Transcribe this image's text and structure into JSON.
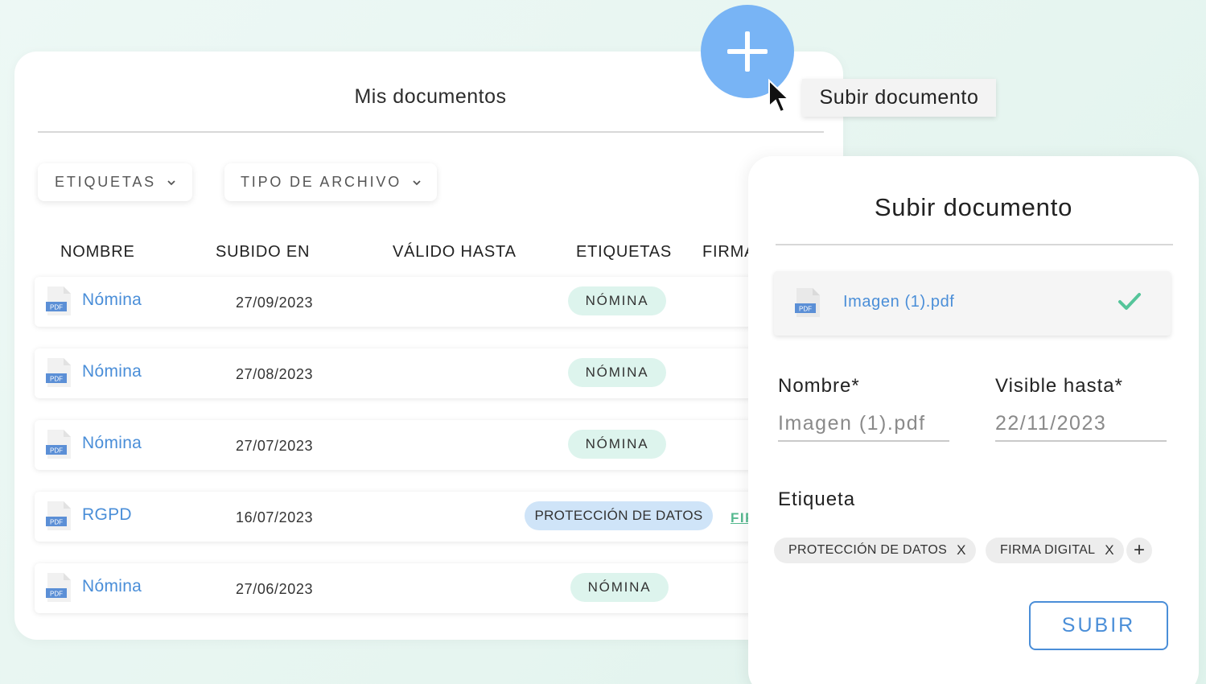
{
  "docs": {
    "title": "Mis documentos",
    "filters": [
      {
        "label": "ETIQUETAS"
      },
      {
        "label": "TIPO DE ARCHIVO"
      }
    ],
    "columns": [
      "NOMBRE",
      "SUBIDO EN",
      "VÁLIDO HASTA",
      "ETIQUETAS",
      "FIRMA"
    ],
    "rows": [
      {
        "name": "Nómina",
        "date": "27/09/2023",
        "tag": "NÓMINA",
        "icon_label": "PDF"
      },
      {
        "name": "Nómina",
        "date": "27/08/2023",
        "tag": "NÓMINA",
        "icon_label": "PDF"
      },
      {
        "name": "Nómina",
        "date": "27/07/2023",
        "tag": "NÓMINA",
        "icon_label": "PDF"
      },
      {
        "name": "RGPD",
        "date": "16/07/2023",
        "tag": "PROTECCIÓN DE DATOS",
        "firma": "FIF",
        "icon_label": "PDF"
      },
      {
        "name": "Nómina",
        "date": "27/06/2023",
        "tag": "NÓMINA",
        "icon_label": "PDF"
      }
    ]
  },
  "fab": {
    "icon": "plus-icon",
    "color": "#78b4f5"
  },
  "tooltip": {
    "text": "Subir documento"
  },
  "modal": {
    "title": "Subir documento",
    "file": {
      "name": "Imagen (1).pdf",
      "icon_label": "PDF",
      "status_icon": "check-icon"
    },
    "nombre_label": "Nombre*",
    "nombre_value": "Imagen (1).pdf",
    "visible_label": "Visible hasta*",
    "visible_value": "22/11/2023",
    "etiqueta_label": "Etiqueta",
    "chips": [
      {
        "label": "PROTECCIÓN DE DATOS",
        "remove": "X"
      },
      {
        "label": "FIRMA DIGITAL",
        "remove": "X"
      }
    ],
    "add_chip": "+",
    "submit_label": "SUBIR"
  },
  "colors": {
    "accent": "#4a8ed8",
    "tag_green": "#ddf4ed",
    "tag_blue": "#cfe4f8",
    "check": "#55c59a"
  }
}
